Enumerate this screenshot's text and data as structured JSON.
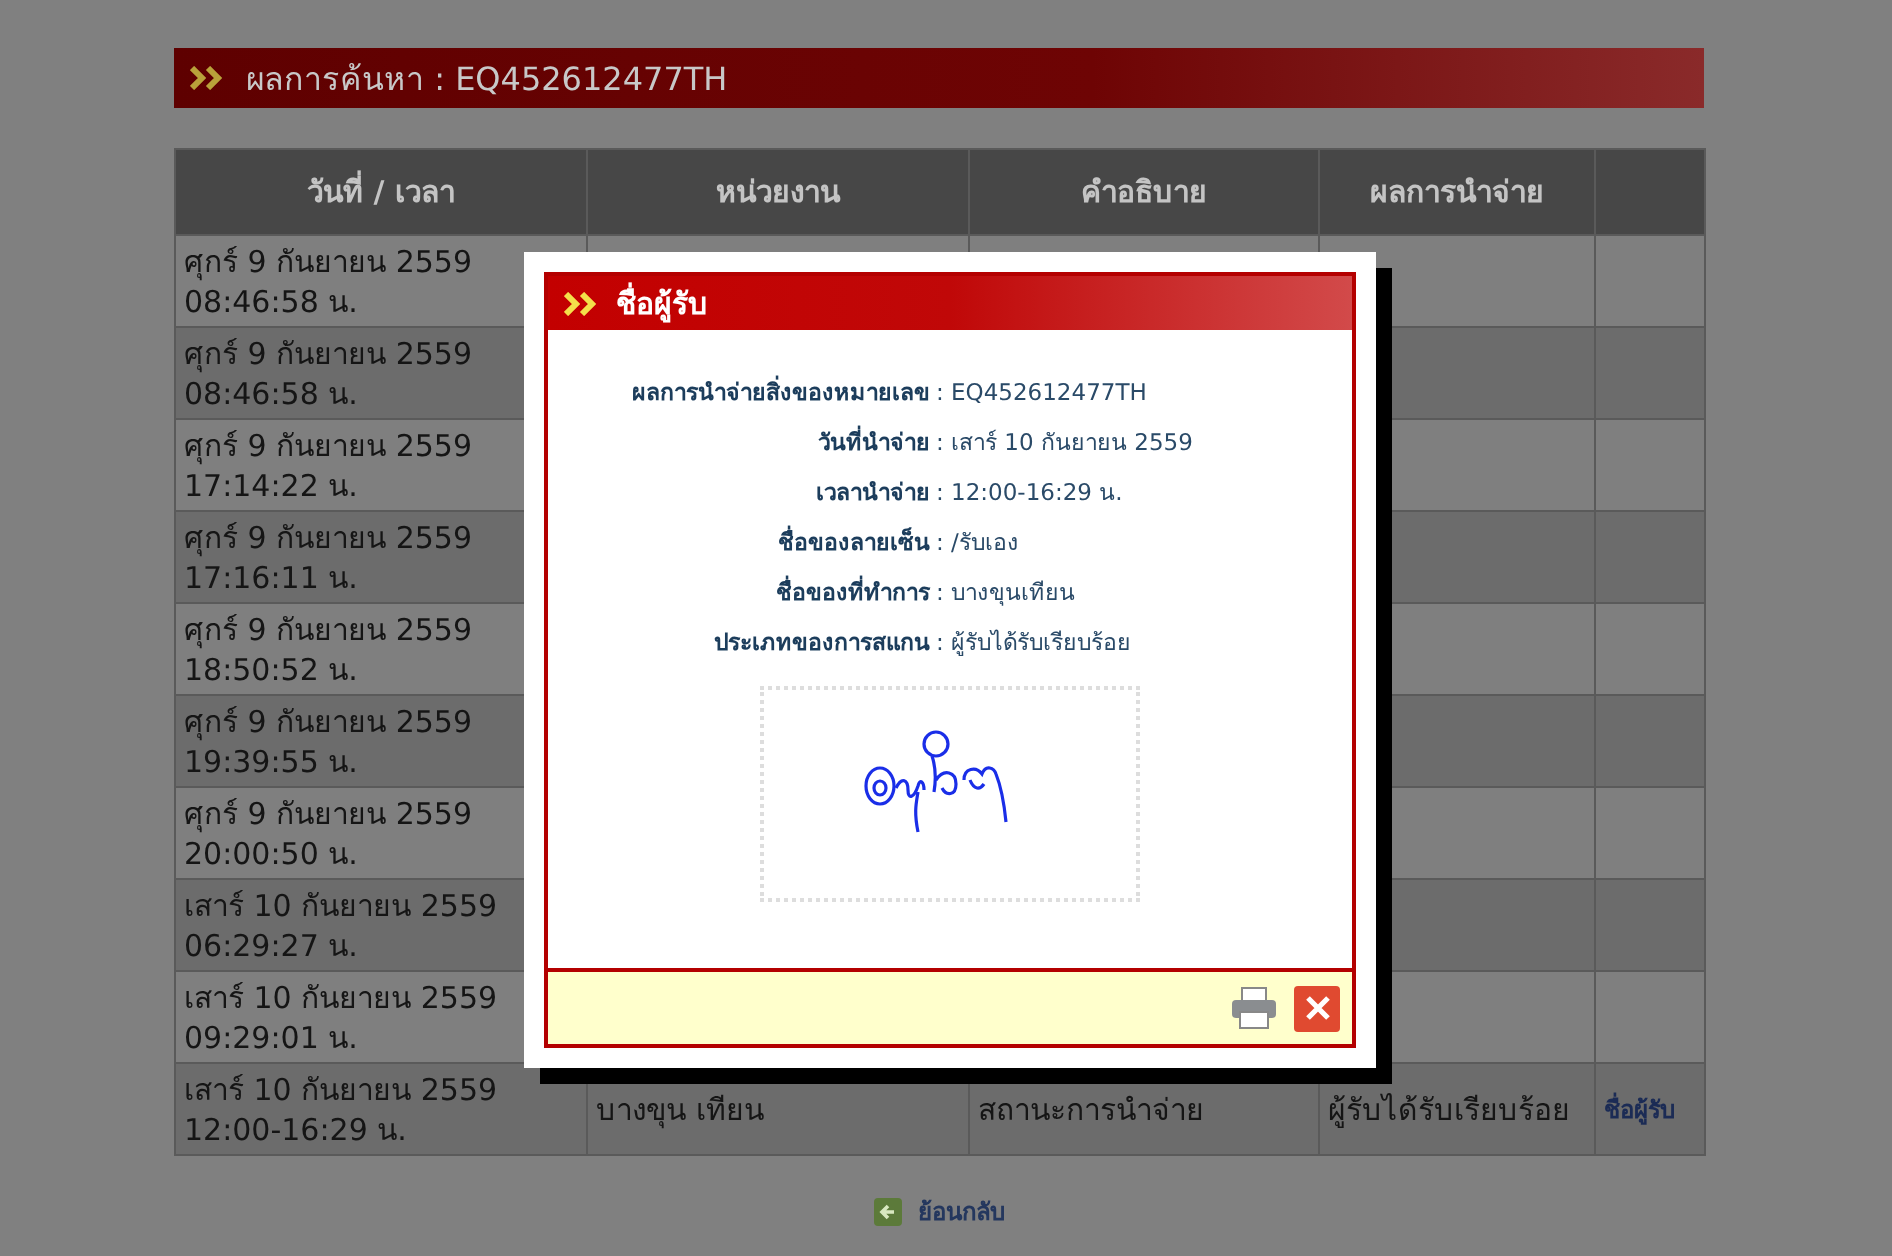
{
  "header": {
    "title": "ผลการค้นหา : EQ452612477TH"
  },
  "table": {
    "columns": [
      "วันที่ / เวลา",
      "หน่วยงาน",
      "คำอธิบาย",
      "ผลการนำจ่าย"
    ],
    "rows": [
      {
        "datetime": "ศุกร์ 9 กันยายน 2559\n08:46:58 น."
      },
      {
        "datetime": "ศุกร์ 9 กันยายน 2559\n08:46:58 น."
      },
      {
        "datetime": "ศุกร์ 9 กันยายน 2559\n17:14:22 น."
      },
      {
        "datetime": "ศุกร์ 9 กันยายน 2559\n17:16:11 น."
      },
      {
        "datetime": "ศุกร์ 9 กันยายน 2559\n18:50:52 น."
      },
      {
        "datetime": "ศุกร์ 9 กันยายน 2559\n19:39:55 น."
      },
      {
        "datetime": "ศุกร์ 9 กันยายน 2559\n20:00:50 น."
      },
      {
        "datetime": "เสาร์ 10 กันยายน 2559\n06:29:27 น."
      },
      {
        "datetime": "เสาร์ 10 กันยายน 2559\n09:29:01 น."
      },
      {
        "datetime": "เสาร์ 10 กันยายน 2559\n12:00-16:29 น.",
        "unit": "บางขุน เทียน",
        "description": "สถานะการนำจ่าย",
        "result": "ผู้รับได้รับเรียบร้อย",
        "link": "ชื่อผู้รับ"
      }
    ]
  },
  "back_link": "ย้อนกลับ",
  "dialog": {
    "title": "ชื่อผู้รับ",
    "fields": [
      {
        "label": "ผลการนำจ่ายสิ่งของหมายเลข",
        "value": ": EQ452612477TH"
      },
      {
        "label": "วันที่นำจ่าย",
        "value": ": เสาร์ 10 กันยายน 2559"
      },
      {
        "label": "เวลานำจ่าย",
        "value": ": 12:00-16:29 น."
      },
      {
        "label": "ชื่อของลายเซ็น",
        "value": ": /รับเอง"
      },
      {
        "label": "ชื่อของที่ทำการ",
        "value": ": บางขุนเทียน"
      },
      {
        "label": "ประเภทของการสแกน",
        "value": ": ผู้รับได้รับเรียบร้อย"
      }
    ]
  }
}
